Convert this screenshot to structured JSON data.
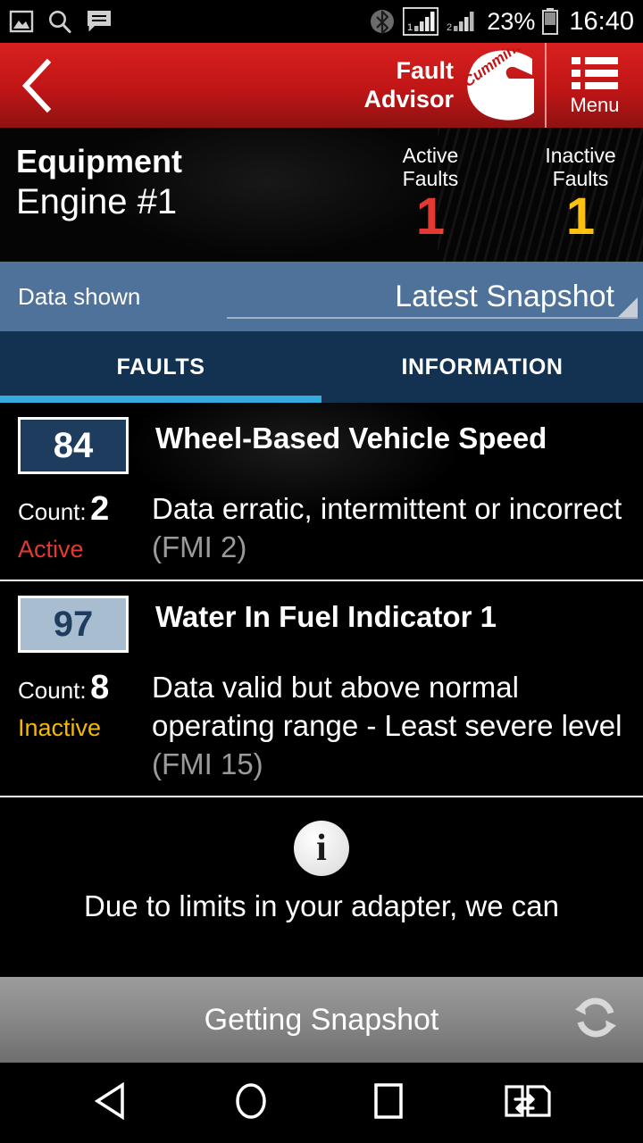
{
  "status_bar": {
    "icons_left": [
      "image-icon",
      "search-icon",
      "message-icon"
    ],
    "icons_right": [
      "bluetooth-icon",
      "signal-sim1-icon",
      "signal-sim2-icon",
      "battery-icon"
    ],
    "battery_percent": "23%",
    "clock": "16:40",
    "sim1_label": "1",
    "sim2_label": "2"
  },
  "appbar": {
    "back_icon": "chevron-left-icon",
    "title": "Fault\nAdvisor",
    "brand_logo": "cummins-logo",
    "brand_text": "Cummins",
    "menu_icon": "list-menu-icon",
    "menu_label": "Menu",
    "background_color": "#c01516"
  },
  "equipment": {
    "label": "Equipment",
    "name": "Engine #1",
    "counters": [
      {
        "title": "Active\nFaults",
        "value": "1",
        "color": "#e23a33",
        "state": "active"
      },
      {
        "title": "Inactive\nFaults",
        "value": "1",
        "color": "#fcc00c",
        "state": "inactive"
      }
    ]
  },
  "data_shown": {
    "label": "Data shown",
    "selected": "Latest Snapshot",
    "caret_icon": "spinner-caret-icon",
    "background_color": "#4e7299"
  },
  "tabs": {
    "items": [
      {
        "label": "FAULTS",
        "selected": true
      },
      {
        "label": "INFORMATION",
        "selected": false
      }
    ],
    "indicator_color": "#35aadd",
    "background_color": "#133251"
  },
  "faults": [
    {
      "spn": "84",
      "name": "Wheel-Based Vehicle Speed",
      "count_label": "Count:",
      "count_value": "2",
      "state": "Active",
      "state_key": "active",
      "state_color": "#e23a33",
      "description": "Data erratic, intermittent or incorrect ",
      "fmi": "(FMI 2)",
      "badge_bg": "#1d3c5e",
      "badge_fg": "#ffffff"
    },
    {
      "spn": "97",
      "name": "Water In Fuel Indicator 1",
      "count_label": "Count:",
      "count_value": "8",
      "state": "Inactive",
      "state_key": "inactive",
      "state_color": "#f5b800",
      "description": "Data valid but above normal operating range - Least severe level ",
      "fmi": "(FMI 15)",
      "badge_bg": "#a8bdd0",
      "badge_fg": "#1d3c5e"
    }
  ],
  "notice": {
    "icon": "info-icon",
    "glyph": "i",
    "text": "Due to limits in your adapter, we can"
  },
  "bottom_bar": {
    "text": "Getting Snapshot",
    "sync_icon": "sync-refresh-icon"
  },
  "nav_bar": {
    "items": [
      "back-triangle-icon",
      "home-circle-icon",
      "recents-square-icon",
      "dual-window-icon"
    ]
  }
}
